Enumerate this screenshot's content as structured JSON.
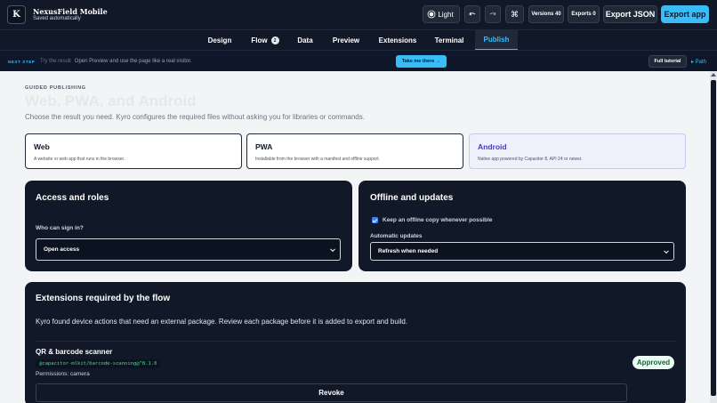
{
  "app": {
    "logo_letter": "K",
    "name": "NexusField Mobile",
    "status": "Saved automatically"
  },
  "toolbar": {
    "theme_label": "Light",
    "undo_icon": "undo-icon",
    "redo_icon": "redo-icon",
    "command_icon": "command-icon",
    "versions_label": "Versions 40",
    "exports_label": "Exports 0",
    "export_json_label": "Export JSON",
    "export_app_label": "Export app"
  },
  "nav": {
    "items": [
      {
        "label": "Design"
      },
      {
        "label": "Flow",
        "badge": "2"
      },
      {
        "label": "Data"
      },
      {
        "label": "Preview"
      },
      {
        "label": "Extensions"
      },
      {
        "label": "Terminal"
      },
      {
        "label": "Publish",
        "active": true
      }
    ]
  },
  "next_step": {
    "label": "NEXT STEP",
    "text": "Try the result",
    "detail": "Open Preview and use the page like a real visitor.",
    "button": "Take me there →",
    "tutorial": "Full tutorial",
    "path": "▸ Path"
  },
  "publish": {
    "eyebrow": "GUIDED PUBLISHING",
    "title": "Web, PWA, and Android",
    "description": "Choose the result you need. Kyro configures the required files without asking you for libraries or commands.",
    "targets": [
      {
        "title": "Web",
        "description": "A website or web app that runs in the browser."
      },
      {
        "title": "PWA",
        "description": "Installable from the browser with a manifest and offline support."
      },
      {
        "title": "Android",
        "description": "Native app powered by Capacitor 8, API 24 or newer.",
        "selected": true
      }
    ]
  },
  "access": {
    "title": "Access and roles",
    "signin_label": "Who can sign in?",
    "signin_value": "Open access"
  },
  "offline": {
    "title": "Offline and updates",
    "offline_copy_label": "Keep an offline copy whenever possible",
    "offline_copy_checked": true,
    "updates_label": "Automatic updates",
    "updates_value": "Refresh when needed"
  },
  "extensions": {
    "title": "Extensions required by the flow",
    "description": "Kyro found device actions that need an external package. Review each package before it is added to export and build.",
    "packages": [
      {
        "name": "QR & barcode scanner",
        "package": "@capacitor-mlkit/barcode-scanning@^8.1.0",
        "permissions": "Permissions: camera",
        "status": "Approved",
        "action": "Revoke"
      }
    ]
  },
  "colors": {
    "accent": "#38bdf8",
    "topbar": "#111827",
    "selected_card": "#eef0fb",
    "selected_title": "#4338ca",
    "approved_text": "#166534"
  }
}
